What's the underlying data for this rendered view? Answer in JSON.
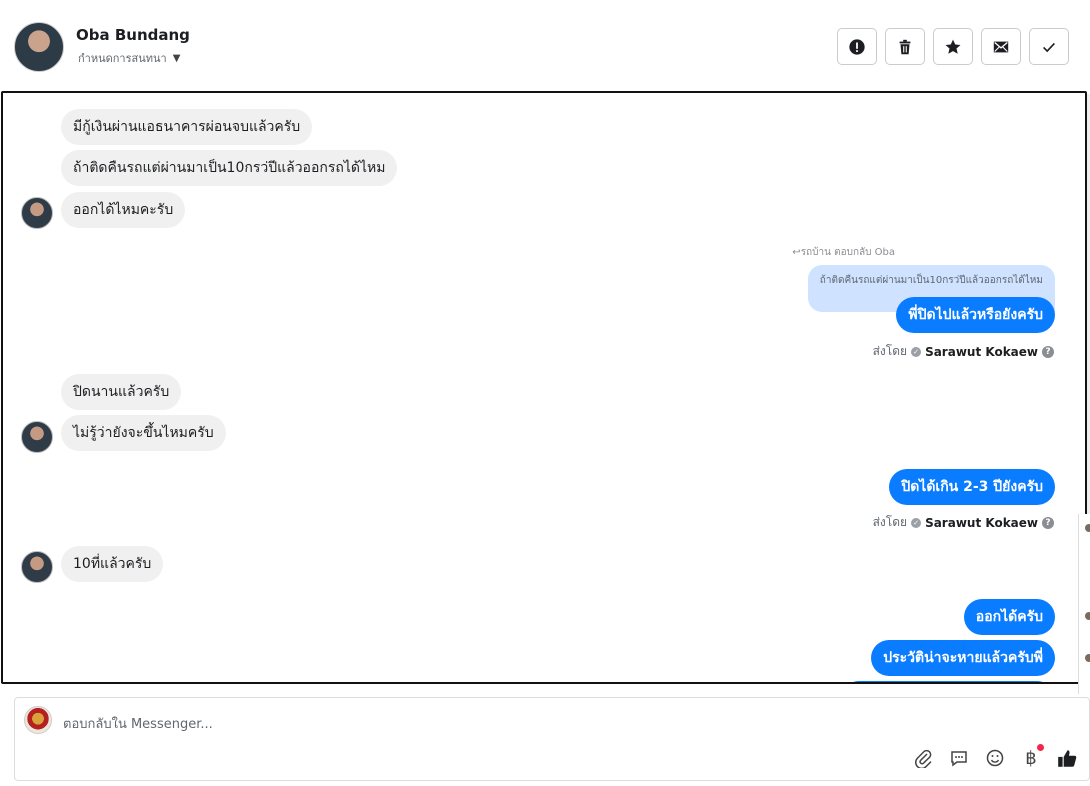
{
  "header": {
    "contact_name": "Oba Bundang",
    "assign_label": "กำหนดการสนทนา",
    "toolbar": [
      {
        "name": "mark-spam-button",
        "icon": "exclamation-icon"
      },
      {
        "name": "delete-button",
        "icon": "trash-icon"
      },
      {
        "name": "star-button",
        "icon": "star-icon"
      },
      {
        "name": "mark-unread-button",
        "icon": "envelope-icon"
      },
      {
        "name": "mark-done-button",
        "icon": "checkmark-icon"
      }
    ]
  },
  "messages": {
    "in_1": "มีกู้เงินผ่านแอธนาคารผ่อนจบแล้วครับ",
    "in_2": "ถ้าติดคืนรถแต่ผ่านมาเป็น10กรว่ปีแล้วออกรถได้ไหม",
    "in_3": "ออกได้ไหมคะรับ",
    "reply_label": "รถบ้าน ตอบกลับ Oba",
    "reply_quote": "ถ้าติดคืนรถแต่ผ่านมาเป็น10กรว่ปีแล้วออกรถได้ไหม",
    "out_1": "พี่ปิดไปแล้วหรือยังครับ",
    "in_4": "ปิดนานแล้วครับ",
    "in_5": "ไม่รู้ว่ายังจะขึ้นไหมครับ",
    "out_2": "ปิดได้เกิน 2-3 ปียังครับ",
    "in_6": "10ที่แล้วครับ",
    "out_3": "ออกได้ครับ",
    "out_4": "ประวัติน่าจะหายแล้วครับพี่"
  },
  "sent_by": {
    "label": "ส่งโดย",
    "agent": "Sarawut Kokaew"
  },
  "composer": {
    "placeholder": "ตอบกลับใน Messenger..."
  },
  "colors": {
    "outgoing_bubble": "#0a7cff",
    "incoming_bubble": "#f0f0f0",
    "reply_quote": "#cfe2ff"
  }
}
